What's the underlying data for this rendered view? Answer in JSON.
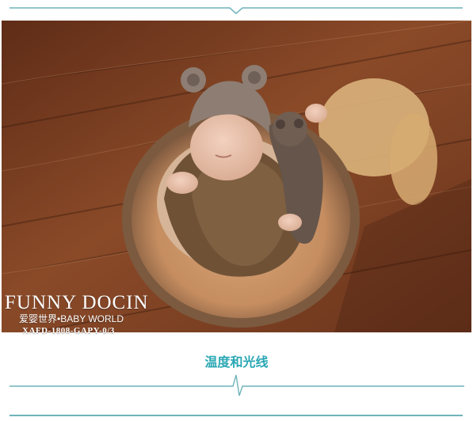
{
  "watermark": {
    "brand": "FUNNY DOCIN",
    "subtitle": "爱婴世界•BABY WORLD",
    "code": "XAFD-1808-GAPY-0/3"
  },
  "section": {
    "title": "温度和光线"
  },
  "colors": {
    "accent": "#2aa8b4",
    "rule": "#6fb4b9",
    "wood": "#7a3f22"
  }
}
